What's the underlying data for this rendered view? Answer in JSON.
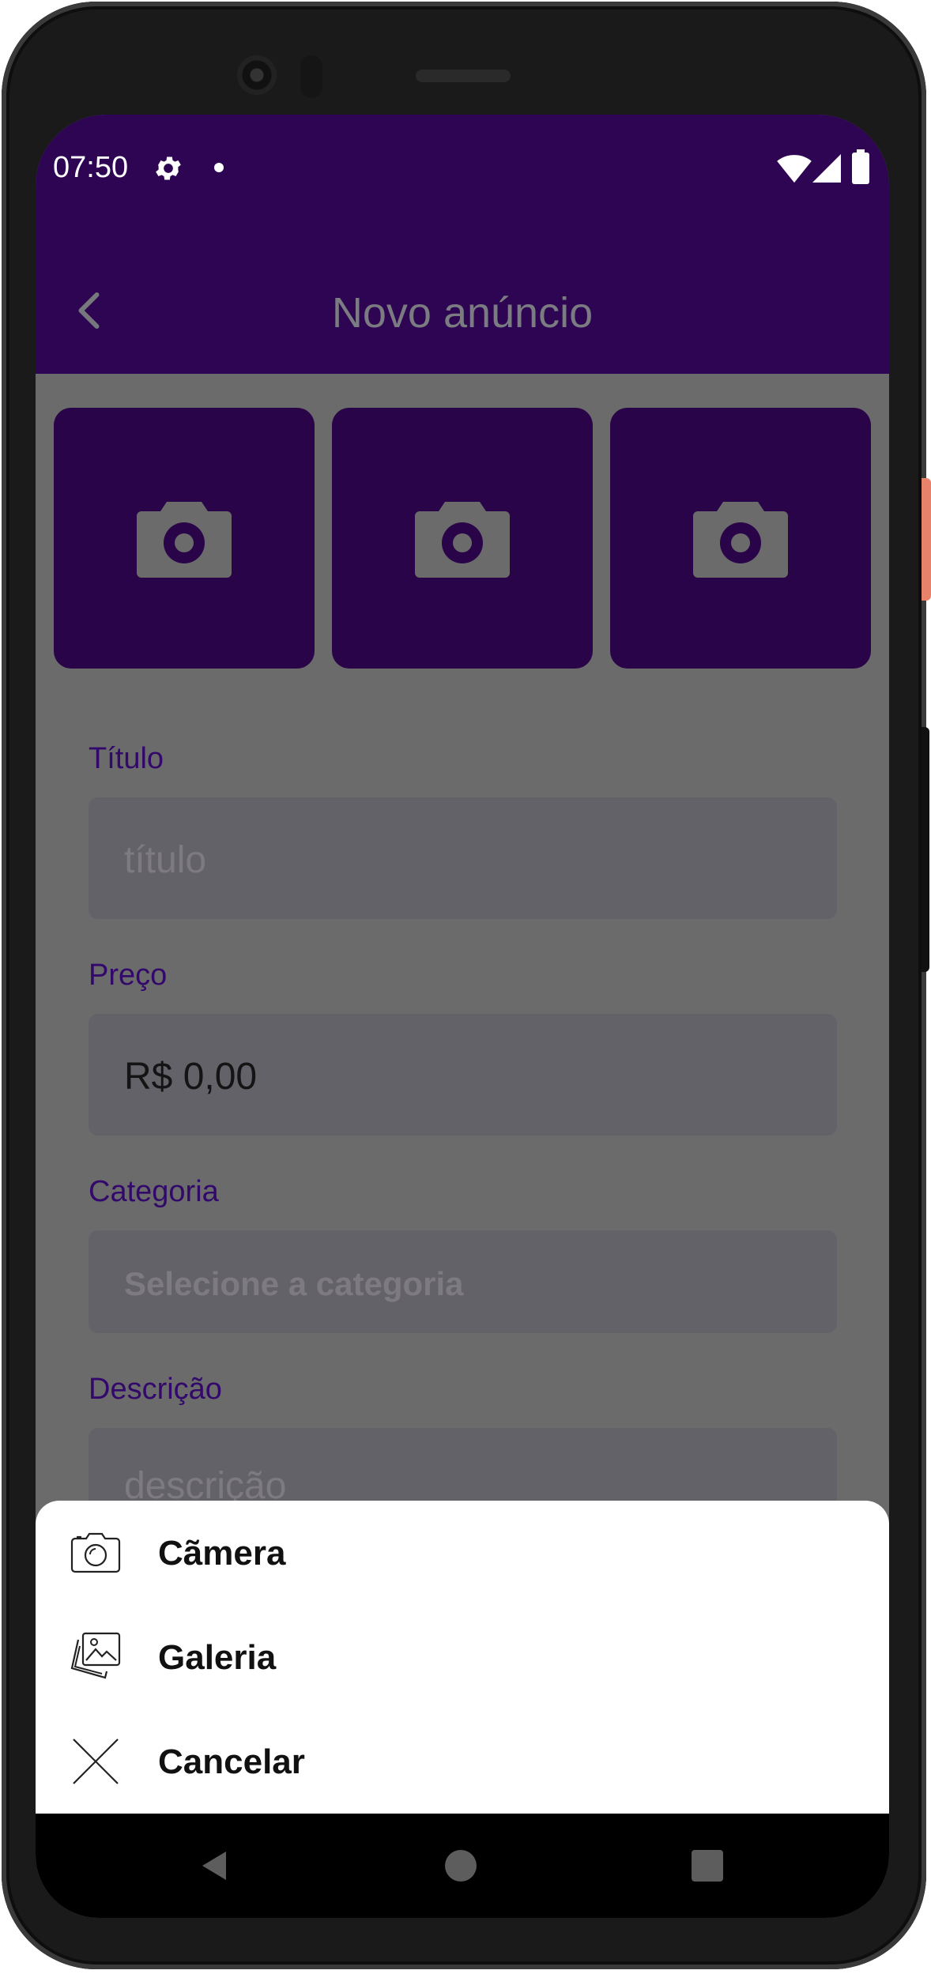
{
  "status_bar": {
    "time": "07:50"
  },
  "app_bar": {
    "title": "Novo anúncio"
  },
  "photos": [
    {
      "icon": "camera-icon"
    },
    {
      "icon": "camera-icon"
    },
    {
      "icon": "camera-icon"
    }
  ],
  "form": {
    "title": {
      "label": "Título",
      "placeholder": "título"
    },
    "price": {
      "label": "Preço",
      "value": "R$ 0,00"
    },
    "category": {
      "label": "Categoria",
      "placeholder": "Selecione a categoria"
    },
    "description": {
      "label": "Descrição",
      "placeholder": "descrição"
    }
  },
  "bottom_sheet": {
    "items": [
      {
        "label": "Cãmera",
        "icon": "camera-outline-icon"
      },
      {
        "label": "Galeria",
        "icon": "gallery-icon"
      },
      {
        "label": "Cancelar",
        "icon": "close-icon"
      }
    ]
  },
  "colors": {
    "primary": "#2e0552",
    "label": "#32096b",
    "scrim": "#6b6b6b",
    "sheet": "#ffffff"
  }
}
